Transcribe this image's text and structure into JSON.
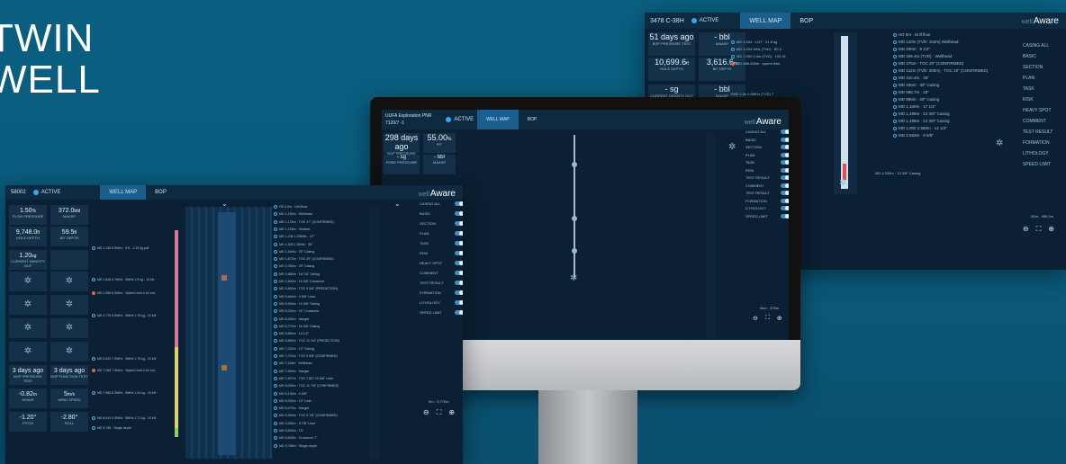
{
  "hero": {
    "line1": "TWIN",
    "line2": "WELL"
  },
  "left_app": {
    "well_id": "58002",
    "status": "ACTIVE",
    "tabs": [
      "WELL MAP",
      "BOP"
    ],
    "brand": "Aware",
    "tiles": [
      {
        "value": "1.50",
        "unit": "%",
        "label": "FLOW PRESSURE"
      },
      {
        "value": "372.0",
        "unit": "bbl",
        "label": "MAASP"
      },
      {
        "value": "9,748.0",
        "unit": "ft",
        "label": "HOLE DEPTH"
      },
      {
        "value": "59.5",
        "unit": "ft",
        "label": "BIT DEPTH"
      },
      {
        "value": "1.20",
        "unit": "sg",
        "label": "CURRENT DENSITY OUT"
      },
      {
        "value": "3 days ago",
        "unit": "",
        "label": "BOP PRESSURE TEST"
      },
      {
        "value": "3 days ago",
        "unit": "",
        "label": "BOP FUNCTION TEST"
      },
      {
        "value": "-0.82",
        "unit": "m",
        "label": "HEAVE"
      },
      {
        "value": "5",
        "unit": "m/s",
        "label": "WIND SPEED"
      },
      {
        "value": "-1.20°",
        "unit": "",
        "label": "PITCH"
      },
      {
        "value": "-2.80°",
        "unit": "",
        "label": "ROLL"
      }
    ],
    "toggles": [
      "CASING ALL",
      "BASIC",
      "SECTION",
      "PLAN",
      "TASK",
      "RISK",
      "HEAVY SPOT",
      "COMMENT",
      "TEST RESULT",
      "FORMATION",
      "LITHOLOGY",
      "SPEED LIMIT"
    ],
    "annotations": [
      "MD 1,136 0.5MHz · 5 ft - 1.25 kg  pull",
      "MD 1,646 5.7MHz · 5MHz 1.5 kg - 10 kN ·",
      "MD 2,558 6.0MHz · Speed Limit 0.01 m/s",
      "MD 3,776 5.0MHz · 5MHz 1.75 kg - 10 kN ·",
      "MD 5,620 7.0MHz · 5MHz 1.75 kg - 10 kN ·",
      "MD 7,068 7.3MHz · Speed Limit 0.01 m/s",
      "MD 7,568 8.2MHz · 5MHz 1.54 kg - 10 kN ·",
      "MD 8,610 9.3MHz · 5MHz 1.71 kg - 10 kN ·",
      "MD 9,748 · Single depth"
    ],
    "right_list": [
      "HD 0.0m · Drill floor",
      "MD 1,150m · Wellhead",
      "MD 1,178m · TOC 17\" (CONFIRMED)",
      "MD 1,218m · Seabed",
      "MD 1,236 1.25MHz · 47\"",
      "MD 1,328 1.5MHz · 36\"",
      "MD 1,440m · 30\" Casing",
      "MD 1,872m · TOC 20\" (CONFIRMED)",
      "MD 2,050m · 20\" Casing",
      "MD 2,680m · 18 7/8\" Tubing",
      "MD 2,800m · 13 3/8\" Crossover",
      "MD 3,800m · TOC 9 5/8\" (PREDICTION)",
      "MD 5,640m · 9 5/8\" Liner",
      "MD 5,900m · 13 3/8\" Tubing",
      "MD 6,020m · 20\" Crossover",
      "MD 6,480m · Hanger",
      "MD 6,770m · 16 3/8\" Casing",
      "MD 6,860m · 14 1/2\"",
      "MD 6,890m · TOC 11 3/4\" (PREDICTION)",
      "MD 7,022m · 12\" Tubing",
      "MD 7,070m · TOC 9 5/8\" (CONFIRMED)",
      "MD 7,116m · Wellhead",
      "MD 7,690m · Hanger",
      "MD 7,827m · TVD 7,827 10 5/8\" Liner",
      "MD 8,054m · TOC 11 7/8\" (CONFIRMED)",
      "MD 8,130m · 9 5/8\"",
      "MD 8,200m · 10\" Liner",
      "MD 8,470m · Hanger",
      "MD 9,400m · TOC 9 7/8\" (CONFIRMED)",
      "MD 9,450m · 9 7/8\" Liner",
      "MD 9,500m · TD",
      "MD 9,600m · Crossover 7\"",
      "MD 9,748m · Single depth"
    ],
    "range": "0m - 9,770m"
  },
  "monitor_app": {
    "well_name": "UUFA Exploration PNR",
    "well_sub": "7120/7 -1",
    "status": "ACTIVE",
    "tabs": [
      "WELL MAP",
      "BOP"
    ],
    "brand": "Aware",
    "tiles": [
      {
        "value": "298 days ago",
        "unit": "",
        "label": "BOP PRESSURE TEST"
      },
      {
        "value": "55.00",
        "unit": "%",
        "label": "PIT"
      },
      {
        "value": "- sg",
        "unit": "",
        "label": "PORE PRESSURE"
      },
      {
        "value": "- bbl",
        "unit": "",
        "label": "MAASP"
      }
    ],
    "toggles": [
      "CASING ALL",
      "BASIC",
      "SECTION",
      "PLAN",
      "TASK",
      "RISK",
      "TEST RESULT",
      "COMMENT",
      "TEST RESULT",
      "FORMATION",
      "LITHOLOGY",
      "SPEED LIMIT"
    ],
    "range": "0km - 375m"
  },
  "right_app": {
    "well_id": "3478 C-38H",
    "status": "ACTIVE",
    "tabs": [
      "WELL MAP",
      "BOP"
    ],
    "brand": "Aware",
    "tiles": [
      {
        "value": "51 days ago",
        "unit": "",
        "label": "BOP PRESSURE TEST"
      },
      {
        "value": "- bbl",
        "unit": "",
        "label": "MAASP"
      },
      {
        "value": "10,699.6",
        "unit": "ft",
        "label": "HOLE DEPTH"
      },
      {
        "value": "3,616.6",
        "unit": "m",
        "label": "BIT DEPTH"
      },
      {
        "value": "- sg",
        "unit": "",
        "label": "CURRENT DENSITY OUT"
      },
      {
        "value": "- bbl",
        "unit": "",
        "label": "MAASP"
      }
    ],
    "toggles": [
      "CASING ALL",
      "BASIC",
      "SECTION",
      "PLAN",
      "TASK",
      "RISK",
      "HEAVY SPOT",
      "COMMENT",
      "TEST RESULT",
      "FORMATION",
      "LITHOLOGY",
      "SPEED LIMIT"
    ],
    "annotations_left": [
      "MD 1,004 · LOT · 21.5 sg",
      "MD 1,004 MHz (TVD) · 80.3",
      "MD 2,000 0.4m (TVD) · 100.41",
      "MD 485-400m · speed limit"
    ],
    "right_list": [
      "HD 0m · Drill floor",
      "MD 120m (TVD: 153m) Wellhead",
      "MD 290m · 8 1/2\"",
      "MD 406.4m (TVD) · Wellhead",
      "MD 475m · TOC 20\" (CONFIRMED)",
      "MD 412m (TVD: 300m) · TOC 10\" (CONFIRMED)",
      "MD 410.4m · 36\"",
      "MD 495m · 30\" Casing",
      "MD 588.7m · 26\"",
      "MD 999m · 20\" Casing",
      "MD 1,100m · 17 1/2\"",
      "MD 1,495m · 13 3/8\" Casing",
      "MD 1,495m · 13 3/8\" Casing",
      "MD 1,000 2,580m · 12 1/4\"",
      "MD 2,563m · 9 5/8\""
    ],
    "bottom_left_ann": "BHD 1,0x 0.5MHz (TVD) 7",
    "bottom_ann": "MD 4,330m · 13 3/8\" Casing",
    "range": "-50m - 486.0m"
  }
}
